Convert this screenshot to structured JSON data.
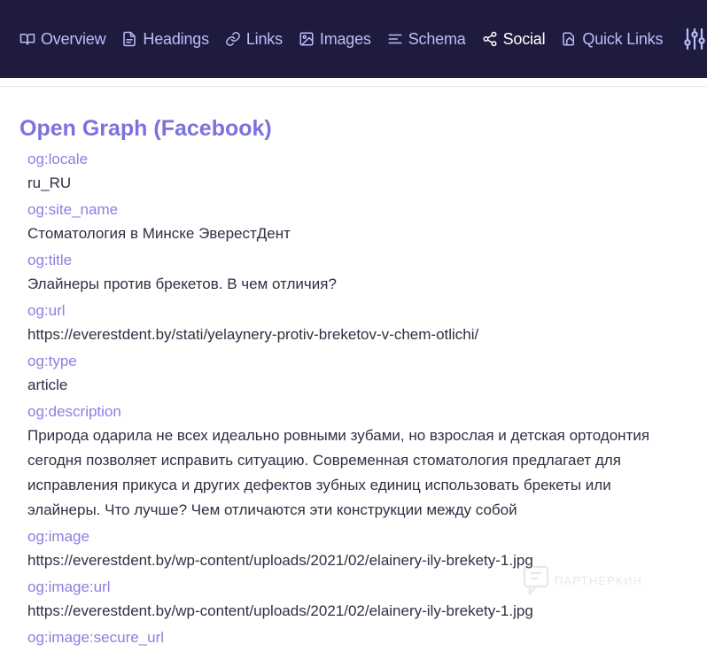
{
  "nav": {
    "tabs": [
      {
        "label": "Overview",
        "icon": "book-icon"
      },
      {
        "label": "Headings",
        "icon": "document-icon"
      },
      {
        "label": "Links",
        "icon": "link-icon"
      },
      {
        "label": "Images",
        "icon": "image-icon"
      },
      {
        "label": "Schema",
        "icon": "list-icon"
      },
      {
        "label": "Social",
        "icon": "share-icon",
        "active": true
      },
      {
        "label": "Quick Links",
        "icon": "quick-links-icon"
      }
    ],
    "settings_icon": "sliders-icon"
  },
  "colors": {
    "topbar_bg": "#1e1b3e",
    "tab_text": "#b9bef8",
    "tab_active": "#ffffff",
    "heading": "#7b72de",
    "key": "#8a80e2",
    "value": "#2d3142"
  },
  "section": {
    "title": "Open Graph (Facebook)",
    "properties": [
      {
        "key": "og:locale",
        "value": "ru_RU"
      },
      {
        "key": "og:site_name",
        "value": "Стоматология в Минске ЭверестДент"
      },
      {
        "key": "og:title",
        "value": "Элайнеры против брекетов. В чем отличия?"
      },
      {
        "key": "og:url",
        "value": "https://everestdent.by/stati/yelaynery-protiv-breketov-v-chem-otlichi/"
      },
      {
        "key": "og:type",
        "value": "article"
      },
      {
        "key": "og:description",
        "value": "Природа одарила не всех идеально ровными зубами, но взрослая и детская ортодонтия сегодня позволяет исправить ситуацию. Современная стоматология предлагает для исправления прикуса и других дефектов зубных единиц использовать брекеты или элайнеры. Что лучше? Чем отличаются эти конструкции между собой"
      },
      {
        "key": "og:image",
        "value": "https://everestdent.by/wp-content/uploads/2021/02/elainery-ily-brekety-1.jpg"
      },
      {
        "key": "og:image:url",
        "value": "https://everestdent.by/wp-content/uploads/2021/02/elainery-ily-brekety-1.jpg"
      },
      {
        "key": "og:image:secure_url",
        "value": ""
      }
    ]
  },
  "watermark": {
    "text": "ПАРТНЕРКИН"
  }
}
